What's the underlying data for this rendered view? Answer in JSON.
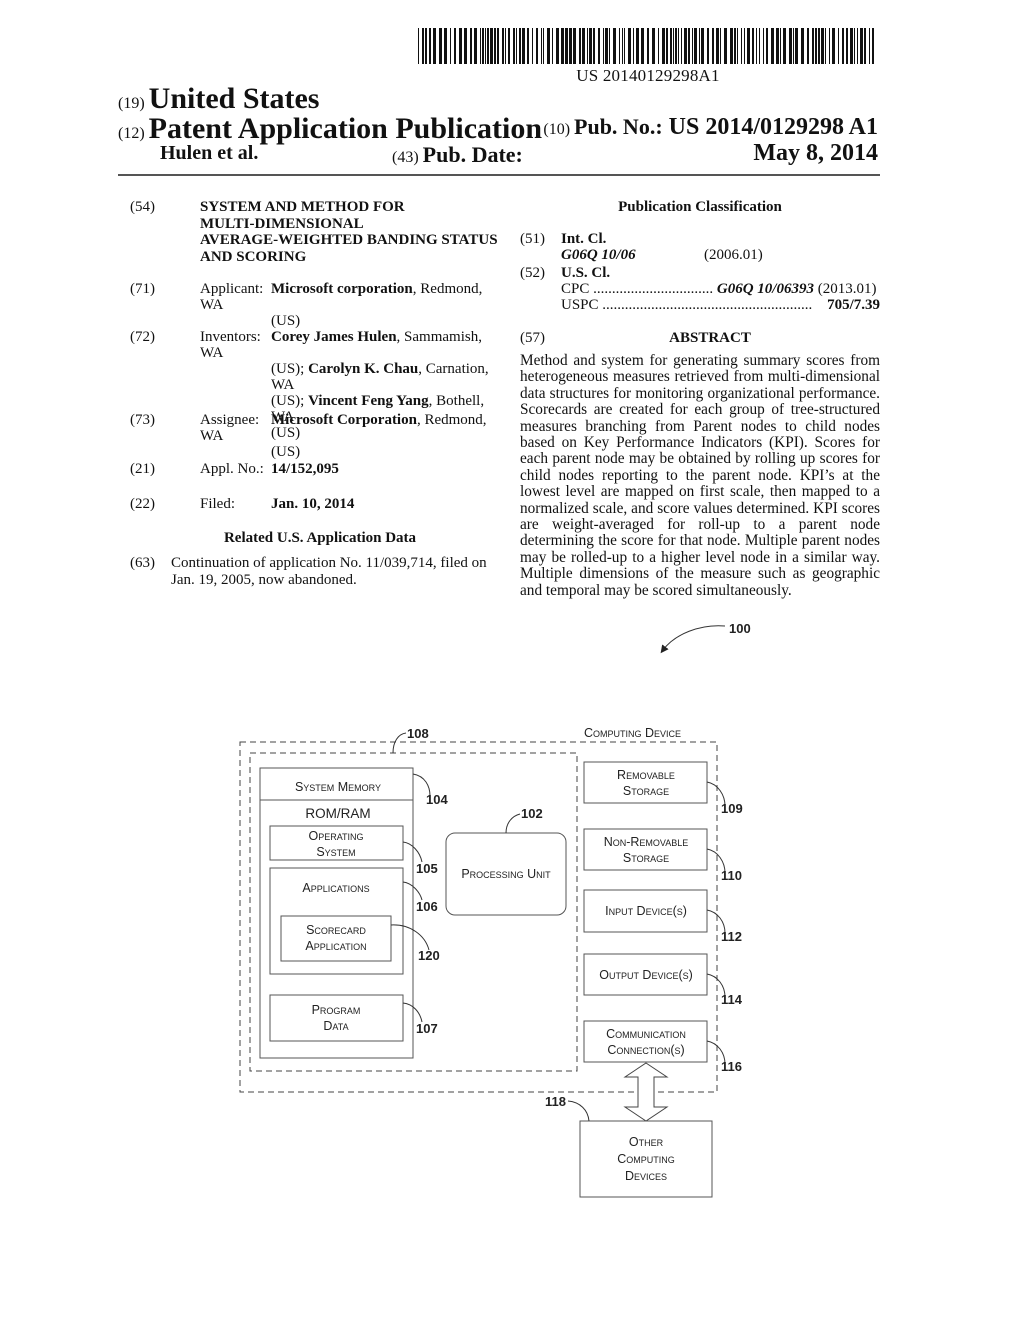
{
  "header": {
    "barcode_number": "US 20140129298A1",
    "country_tag": "(19)",
    "country": "United States",
    "kind_tag": "(12)",
    "kind": "Patent Application Publication",
    "inventor_short": "Hulen et al.",
    "pub_no_tag": "(10)",
    "pub_no_label": "Pub. No.:",
    "pub_no": "US 2014/0129298 A1",
    "pub_date_tag": "(43)",
    "pub_date_label": "Pub. Date:",
    "pub_date": "May 8, 2014"
  },
  "biblio": {
    "title": {
      "tag": "(54)",
      "lines": [
        "SYSTEM AND METHOD FOR",
        "MULTI-DIMENSIONAL",
        "AVERAGE-WEIGHTED BANDING STATUS",
        "AND SCORING"
      ]
    },
    "applicant": {
      "tag": "(71)",
      "label": "Applicant:",
      "name": "Microsoft corporation",
      "location": ", Redmond, WA",
      "country": "(US)"
    },
    "inventors": {
      "tag": "(72)",
      "label": "Inventors:",
      "list": [
        {
          "name": "Corey James Hulen",
          "location": ", Sammamish, WA"
        },
        {
          "name": "Carolyn K. Chau",
          "location": ", Carnation, WA"
        },
        {
          "name": "Vincent Feng Yang",
          "location": ", Bothell, WA"
        }
      ],
      "country": "(US)",
      "sep": "(US); "
    },
    "assignee": {
      "tag": "(73)",
      "label": "Assignee:",
      "name": "Microsoft Corporation",
      "location": ", Redmond, WA",
      "country": "(US)"
    },
    "appl_no": {
      "tag": "(21)",
      "label": "Appl. No.:",
      "value": "14/152,095"
    },
    "filed": {
      "tag": "(22)",
      "label": "Filed:",
      "value": "Jan. 10, 2014"
    },
    "related_heading": "Related U.S. Application Data",
    "continuation": {
      "tag": "(63)",
      "line1": "Continuation of application No. 11/039,714, filed on",
      "line2": "Jan. 19, 2005, now abandoned."
    }
  },
  "classification": {
    "heading": "Publication Classification",
    "int_cl": {
      "tag": "(51)",
      "label": "Int. Cl.",
      "code": "G06Q 10/06",
      "version": "(2006.01)"
    },
    "us_cl": {
      "tag": "(52)",
      "label": "U.S. Cl.",
      "cpc_label": "CPC",
      "cpc_dots": "................................",
      "cpc_code": "G06Q 10/06393",
      "cpc_version": "(2013.01)",
      "uspc_label": "USPC",
      "uspc_dots": "........................................................",
      "uspc_code": "705/7.39"
    }
  },
  "abstract": {
    "tag": "(57)",
    "heading": "ABSTRACT",
    "text": "Method and system for generating summary scores from heterogeneous measures retrieved from multi-dimensional data structures for monitoring organizational performance. Scorecards are created for each group of tree-structured measures branching from Parent nodes to child nodes based on Key Performance Indicators (KPI). Scores for each parent node may be obtained by rolling up scores for child nodes reporting to the parent node. KPI’s at the lowest level are mapped on first scale, then mapped to a normalized scale, and score values determined. KPI scores are weight-averaged for roll-up to a parent node determining the score for that node. Multiple parent nodes may be rolled-up to a higher level node in a similar way. Multiple dimensions of the measure such as geographic and temporal may be scored simultaneously."
  },
  "figure": {
    "ref_figure": "100",
    "device_title": "Computing Device",
    "ref_basic_config": "108",
    "system_memory": "System Memory",
    "ref_system_memory": "104",
    "rom_ram": "ROM/RAM",
    "os_line1": "Operating",
    "os_line2": "System",
    "ref_os": "105",
    "applications": "Applications",
    "ref_applications": "106",
    "scorecard_line1": "Scorecard",
    "scorecard_line2": "Application",
    "ref_scorecard": "120",
    "program_line1": "Program",
    "program_line2": "Data",
    "ref_program": "107",
    "processing_unit": "Processing Unit",
    "ref_processing": "102",
    "removable_line1": "Removable",
    "removable_line2": "Storage",
    "ref_removable": "109",
    "nonremovable_line1": "Non-Removable",
    "nonremovable_line2": "Storage",
    "ref_nonremovable": "110",
    "input": "Input Device(s)",
    "ref_input": "112",
    "output": "Output Device(s)",
    "ref_output": "114",
    "comm_line1": "Communication",
    "comm_line2": "Connection(s)",
    "ref_comm": "116",
    "other_line1": "Other",
    "other_line2": "Computing",
    "other_line3": "Devices",
    "ref_other": "118"
  }
}
